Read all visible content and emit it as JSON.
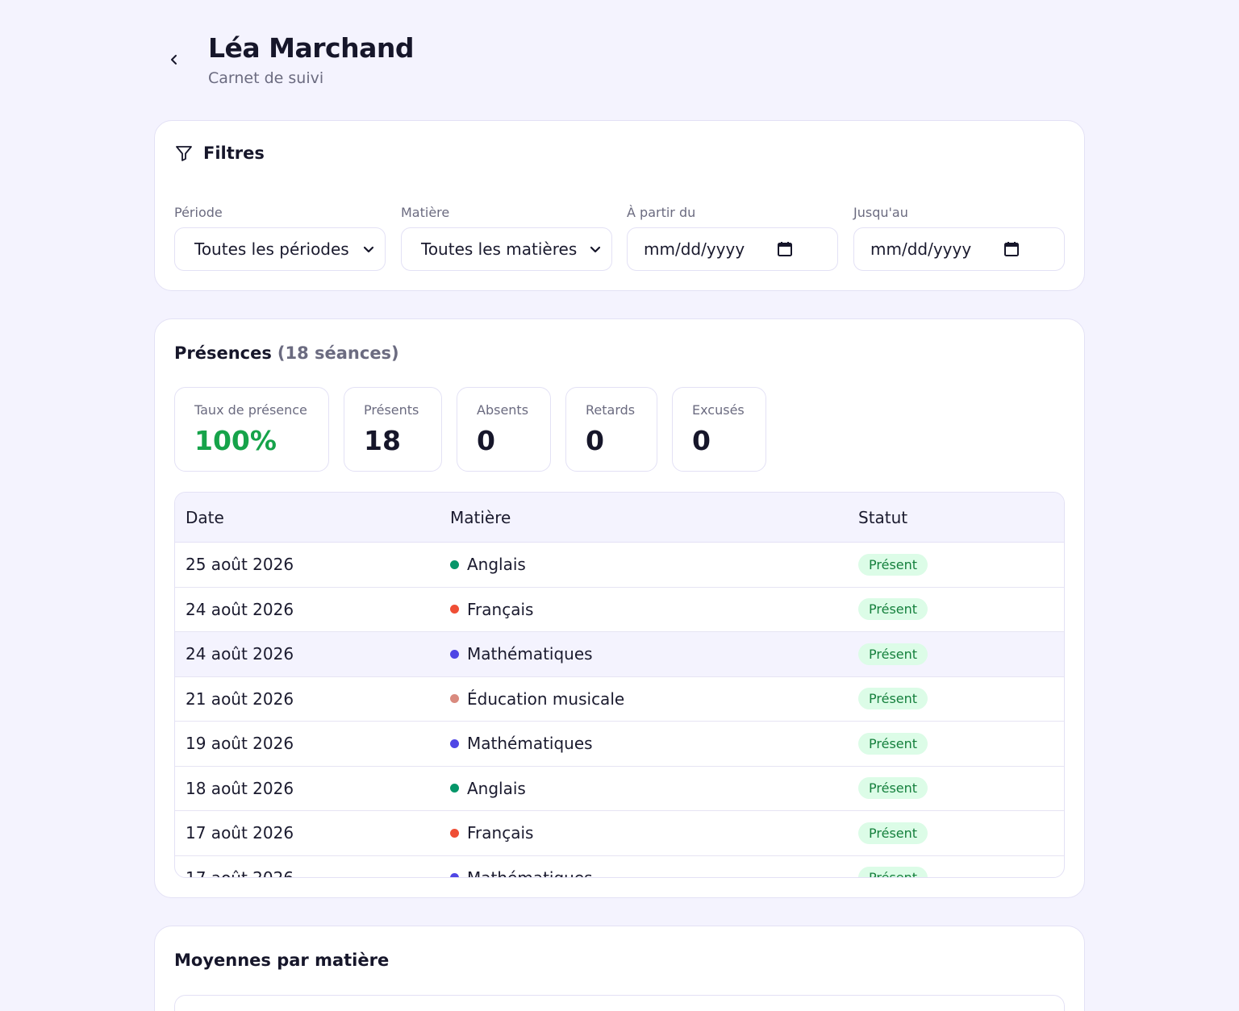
{
  "header": {
    "title": "Léa Marchand",
    "subtitle": "Carnet de suivi"
  },
  "filters": {
    "title": "Filtres",
    "periode": {
      "label": "Période",
      "value": "Toutes les périodes"
    },
    "matiere": {
      "label": "Matière",
      "value": "Toutes les matières"
    },
    "from": {
      "label": "À partir du",
      "value": "mm/dd/yyyy"
    },
    "to": {
      "label": "Jusqu'au",
      "value": "mm/dd/yyyy"
    }
  },
  "presences": {
    "title": "Présences",
    "count": "(18 séances)",
    "stats": {
      "taux": {
        "label": "Taux de présence",
        "value": "100%"
      },
      "presents": {
        "label": "Présents",
        "value": "18"
      },
      "absents": {
        "label": "Absents",
        "value": "0"
      },
      "retards": {
        "label": "Retards",
        "value": "0"
      },
      "excuses": {
        "label": "Excusés",
        "value": "0"
      }
    },
    "table": {
      "headers": {
        "date": "Date",
        "matiere": "Matière",
        "statut": "Statut"
      },
      "rows": [
        {
          "date": "25 août 2026",
          "subject": "Anglais",
          "status": "Présent",
          "color": "#059669"
        },
        {
          "date": "24 août 2026",
          "subject": "Français",
          "status": "Présent",
          "color": "#ef4e35"
        },
        {
          "date": "24 août 2026",
          "subject": "Mathématiques",
          "status": "Présent",
          "color": "#4f46e5"
        },
        {
          "date": "21 août 2026",
          "subject": "Éducation musicale",
          "status": "Présent",
          "color": "#d98a7e"
        },
        {
          "date": "19 août 2026",
          "subject": "Mathématiques",
          "status": "Présent",
          "color": "#4f46e5"
        },
        {
          "date": "18 août 2026",
          "subject": "Anglais",
          "status": "Présent",
          "color": "#059669"
        },
        {
          "date": "17 août 2026",
          "subject": "Français",
          "status": "Présent",
          "color": "#ef4e35"
        },
        {
          "date": "17 août 2026",
          "subject": "Mathématiques",
          "status": "Présent",
          "color": "#4f46e5"
        }
      ]
    }
  },
  "moyennes": {
    "title": "Moyennes par matière"
  },
  "colors": {
    "background": "#f4f3fe",
    "accent_green": "#16a34a",
    "badge_bg": "#dcfce7",
    "badge_text": "#15803d"
  },
  "icons": {
    "back": "chevron-left-icon",
    "filter": "filter-icon",
    "select": "chevron-down-icon",
    "calendar": "calendar-icon"
  }
}
